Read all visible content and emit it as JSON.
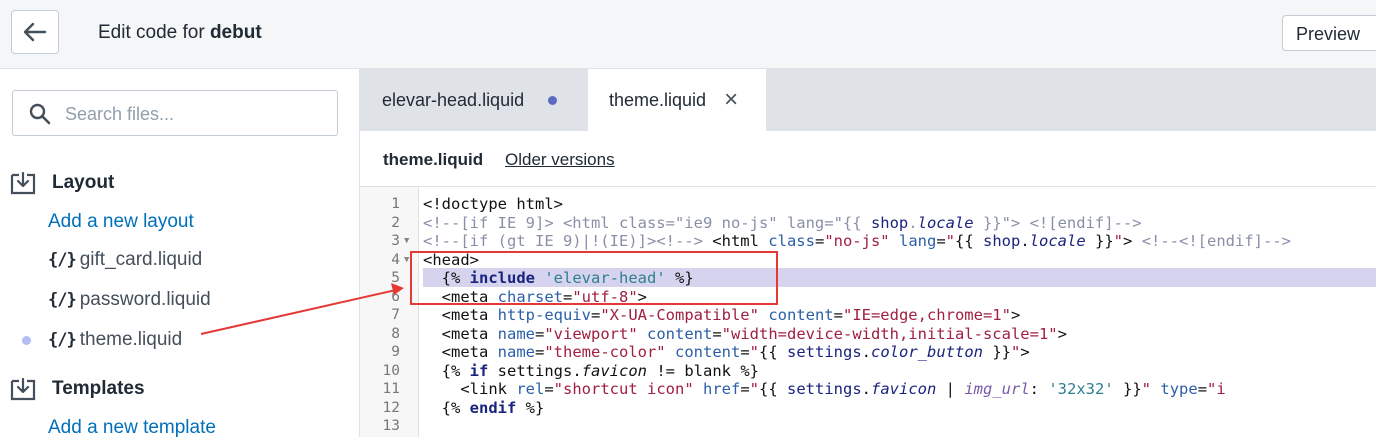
{
  "header": {
    "title_prefix": "Edit code for",
    "theme_name": "debut",
    "preview_label": "Preview"
  },
  "sidebar": {
    "search_placeholder": "Search files...",
    "layout": {
      "label": "Layout",
      "add_link": "Add a new layout",
      "files": [
        "gift_card.liquid",
        "password.liquid",
        "theme.liquid"
      ]
    },
    "templates": {
      "label": "Templates",
      "add_link": "Add a new template"
    },
    "liquid_icon": "{/}"
  },
  "tabs": [
    {
      "label": "elevar-head.liquid",
      "state": "unsaved"
    },
    {
      "label": "theme.liquid",
      "state": "active"
    }
  ],
  "file_header": {
    "name": "theme.liquid",
    "older_versions": "Older versions"
  },
  "editor": {
    "line_numbers": [
      "1",
      "2",
      "3",
      "4",
      "5",
      "6",
      "7",
      "8",
      "9",
      "10",
      "11",
      "12",
      "13"
    ],
    "highlighted_line": 5
  },
  "colors": {
    "accent": "#5c6ac4",
    "link": "#006fbb",
    "annotation": "#e53935"
  }
}
